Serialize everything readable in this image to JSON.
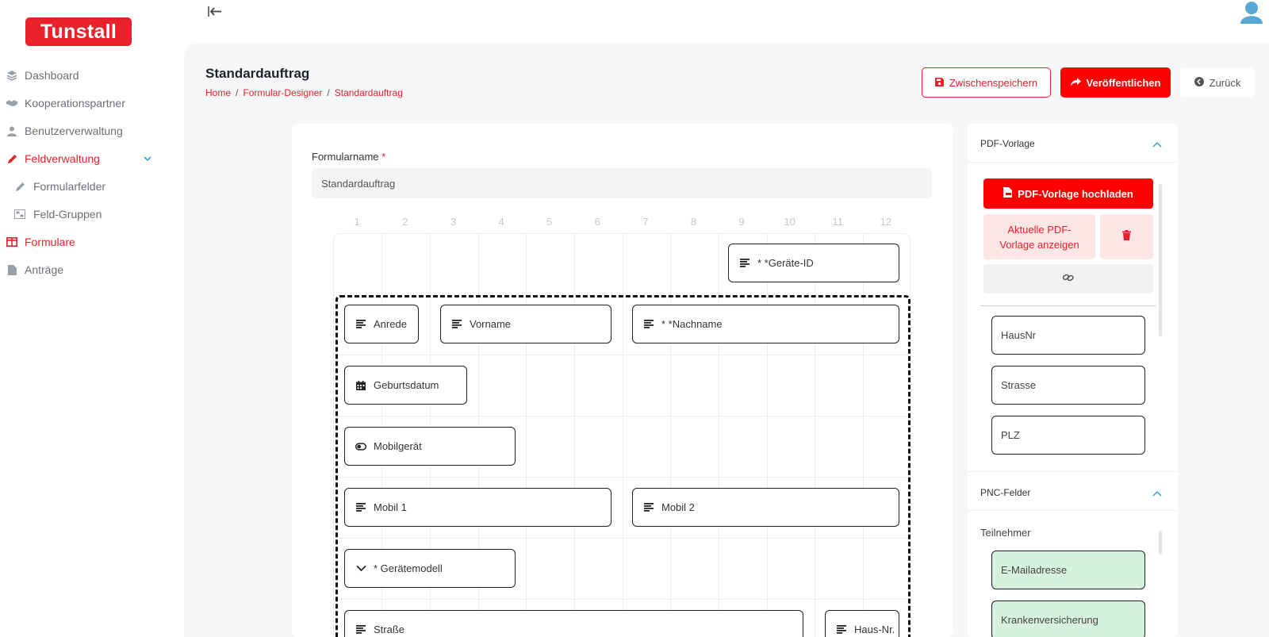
{
  "brand": {
    "logo_text": "Tunstall",
    "accent": "#e8212b"
  },
  "sidebar": {
    "items": [
      {
        "label": "Dashboard",
        "icon": "layers-icon"
      },
      {
        "label": "Kooperationspartner",
        "icon": "handshake-icon"
      },
      {
        "label": "Benutzerverwaltung",
        "icon": "user-icon"
      },
      {
        "label": "Feldverwaltung",
        "icon": "pencil-icon",
        "active": true,
        "expanded": true
      },
      {
        "label": "Formularfelder",
        "icon": "pencil-icon"
      },
      {
        "label": "Feld-Gruppen",
        "icon": "group-icon"
      },
      {
        "label": "Formulare",
        "icon": "table-icon",
        "active": true
      },
      {
        "label": "Anträge",
        "icon": "document-icon"
      }
    ]
  },
  "header": {
    "title": "Standardauftrag",
    "breadcrumb": [
      "Home",
      "Formular-Designer",
      "Standardauftrag"
    ],
    "breadcrumb_sep": "/",
    "buttons": {
      "save": "Zwischenspeichern",
      "publish": "Veröffentlichen",
      "back": "Zurück"
    }
  },
  "form": {
    "name_label": "Formularname",
    "required_mark": "*",
    "name_value": "Standardauftrag",
    "columns": [
      "1",
      "2",
      "3",
      "4",
      "5",
      "6",
      "7",
      "8",
      "9",
      "10",
      "11",
      "12"
    ],
    "fields": [
      {
        "label": "* *Geräte-ID",
        "icon": "text-lines-icon"
      },
      {
        "label": "Anrede",
        "icon": "text-lines-icon"
      },
      {
        "label": "Vorname",
        "icon": "text-lines-icon"
      },
      {
        "label": "* *Nachname",
        "icon": "text-lines-icon"
      },
      {
        "label": "Geburtsdatum",
        "icon": "calendar-icon"
      },
      {
        "label": "Mobilgerät",
        "icon": "toggle-icon"
      },
      {
        "label": "Mobil 1",
        "icon": "text-lines-icon"
      },
      {
        "label": "Mobil 2",
        "icon": "text-lines-icon"
      },
      {
        "label": "* Gerätemodell",
        "icon": "chevron-down-icon"
      },
      {
        "label": "Straße",
        "icon": "text-lines-icon"
      },
      {
        "label": "Haus-Nr.",
        "icon": "text-lines-icon"
      }
    ]
  },
  "right_panel": {
    "pdf_section": {
      "title": "PDF-Vorlage",
      "upload_label": "PDF-Vorlage hochladen",
      "view_label": "Aktuelle PDF-Vorlage anzeigen",
      "fields": [
        "HausNr",
        "Strasse",
        "PLZ"
      ]
    },
    "pnc_section": {
      "title": "PNC-Felder",
      "group_label": "Teilnehmer",
      "fields": [
        "E-Mailadresse",
        "Krankenversicherung"
      ]
    }
  }
}
